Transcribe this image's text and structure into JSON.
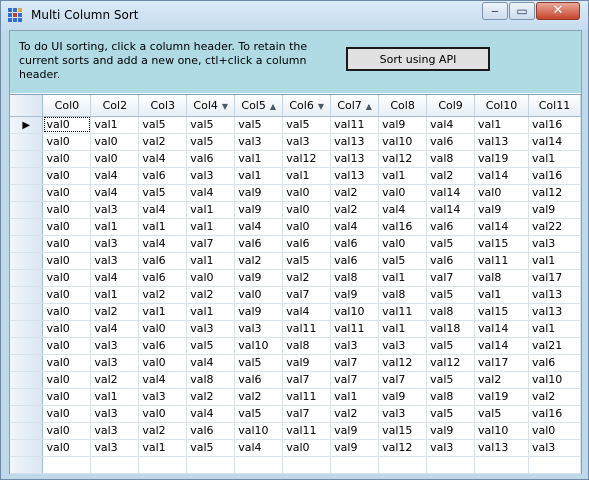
{
  "window": {
    "title": "Multi Column Sort"
  },
  "panel": {
    "instructions": "To do UI sorting, click a column header. To retain the current sorts and add a new one, ctl+click a column header.",
    "sort_button_label": "Sort using API"
  },
  "grid": {
    "columns": [
      {
        "label": "Col0",
        "sort": ""
      },
      {
        "label": "Col2",
        "sort": ""
      },
      {
        "label": "Col3",
        "sort": ""
      },
      {
        "label": "Col4",
        "sort": "▼"
      },
      {
        "label": "Col5",
        "sort": "▲"
      },
      {
        "label": "Col6",
        "sort": "▼"
      },
      {
        "label": "Col7",
        "sort": "▲"
      },
      {
        "label": "Col8",
        "sort": ""
      },
      {
        "label": "Col9",
        "sort": ""
      },
      {
        "label": "Col10",
        "sort": ""
      },
      {
        "label": "Col11",
        "sort": ""
      }
    ],
    "current_row_indicator": "▶",
    "rows": [
      [
        "val0",
        "val1",
        "val5",
        "val5",
        "val5",
        "val5",
        "val11",
        "val9",
        "val4",
        "val1",
        "val16"
      ],
      [
        "val0",
        "val0",
        "val2",
        "val5",
        "val3",
        "val3",
        "val13",
        "val10",
        "val6",
        "val13",
        "val14"
      ],
      [
        "val0",
        "val0",
        "val4",
        "val6",
        "val1",
        "val12",
        "val13",
        "val12",
        "val8",
        "val19",
        "val1"
      ],
      [
        "val0",
        "val4",
        "val6",
        "val3",
        "val1",
        "val1",
        "val13",
        "val1",
        "val2",
        "val14",
        "val16"
      ],
      [
        "val0",
        "val4",
        "val5",
        "val4",
        "val9",
        "val0",
        "val2",
        "val0",
        "val14",
        "val0",
        "val12"
      ],
      [
        "val0",
        "val3",
        "val4",
        "val1",
        "val9",
        "val0",
        "val2",
        "val4",
        "val14",
        "val9",
        "val9"
      ],
      [
        "val0",
        "val1",
        "val1",
        "val1",
        "val4",
        "val0",
        "val4",
        "val16",
        "val6",
        "val14",
        "val22"
      ],
      [
        "val0",
        "val3",
        "val4",
        "val7",
        "val6",
        "val6",
        "val6",
        "val0",
        "val5",
        "val15",
        "val3"
      ],
      [
        "val0",
        "val3",
        "val6",
        "val1",
        "val2",
        "val5",
        "val6",
        "val5",
        "val6",
        "val11",
        "val1"
      ],
      [
        "val0",
        "val4",
        "val6",
        "val0",
        "val9",
        "val2",
        "val8",
        "val1",
        "val7",
        "val8",
        "val17"
      ],
      [
        "val0",
        "val1",
        "val2",
        "val2",
        "val0",
        "val7",
        "val9",
        "val8",
        "val5",
        "val1",
        "val13"
      ],
      [
        "val0",
        "val2",
        "val1",
        "val1",
        "val9",
        "val4",
        "val10",
        "val11",
        "val8",
        "val15",
        "val13"
      ],
      [
        "val0",
        "val4",
        "val0",
        "val3",
        "val3",
        "val11",
        "val11",
        "val1",
        "val18",
        "val14",
        "val1"
      ],
      [
        "val0",
        "val3",
        "val6",
        "val5",
        "val10",
        "val8",
        "val3",
        "val3",
        "val5",
        "val14",
        "val21"
      ],
      [
        "val0",
        "val3",
        "val0",
        "val4",
        "val5",
        "val9",
        "val7",
        "val12",
        "val12",
        "val17",
        "val6"
      ],
      [
        "val0",
        "val2",
        "val4",
        "val8",
        "val6",
        "val7",
        "val7",
        "val7",
        "val5",
        "val2",
        "val10"
      ],
      [
        "val0",
        "val1",
        "val3",
        "val2",
        "val2",
        "val11",
        "val1",
        "val9",
        "val8",
        "val19",
        "val2"
      ],
      [
        "val0",
        "val3",
        "val0",
        "val4",
        "val5",
        "val7",
        "val2",
        "val3",
        "val5",
        "val5",
        "val16"
      ],
      [
        "val0",
        "val3",
        "val2",
        "val6",
        "val10",
        "val11",
        "val9",
        "val15",
        "val9",
        "val10",
        "val0"
      ],
      [
        "val0",
        "val3",
        "val1",
        "val5",
        "val4",
        "val0",
        "val9",
        "val12",
        "val3",
        "val13",
        "val3"
      ]
    ]
  },
  "colors": {
    "panel_background": "#b0dbe5",
    "title_bar": "#c4dcef",
    "close_button": "#c6442c"
  }
}
